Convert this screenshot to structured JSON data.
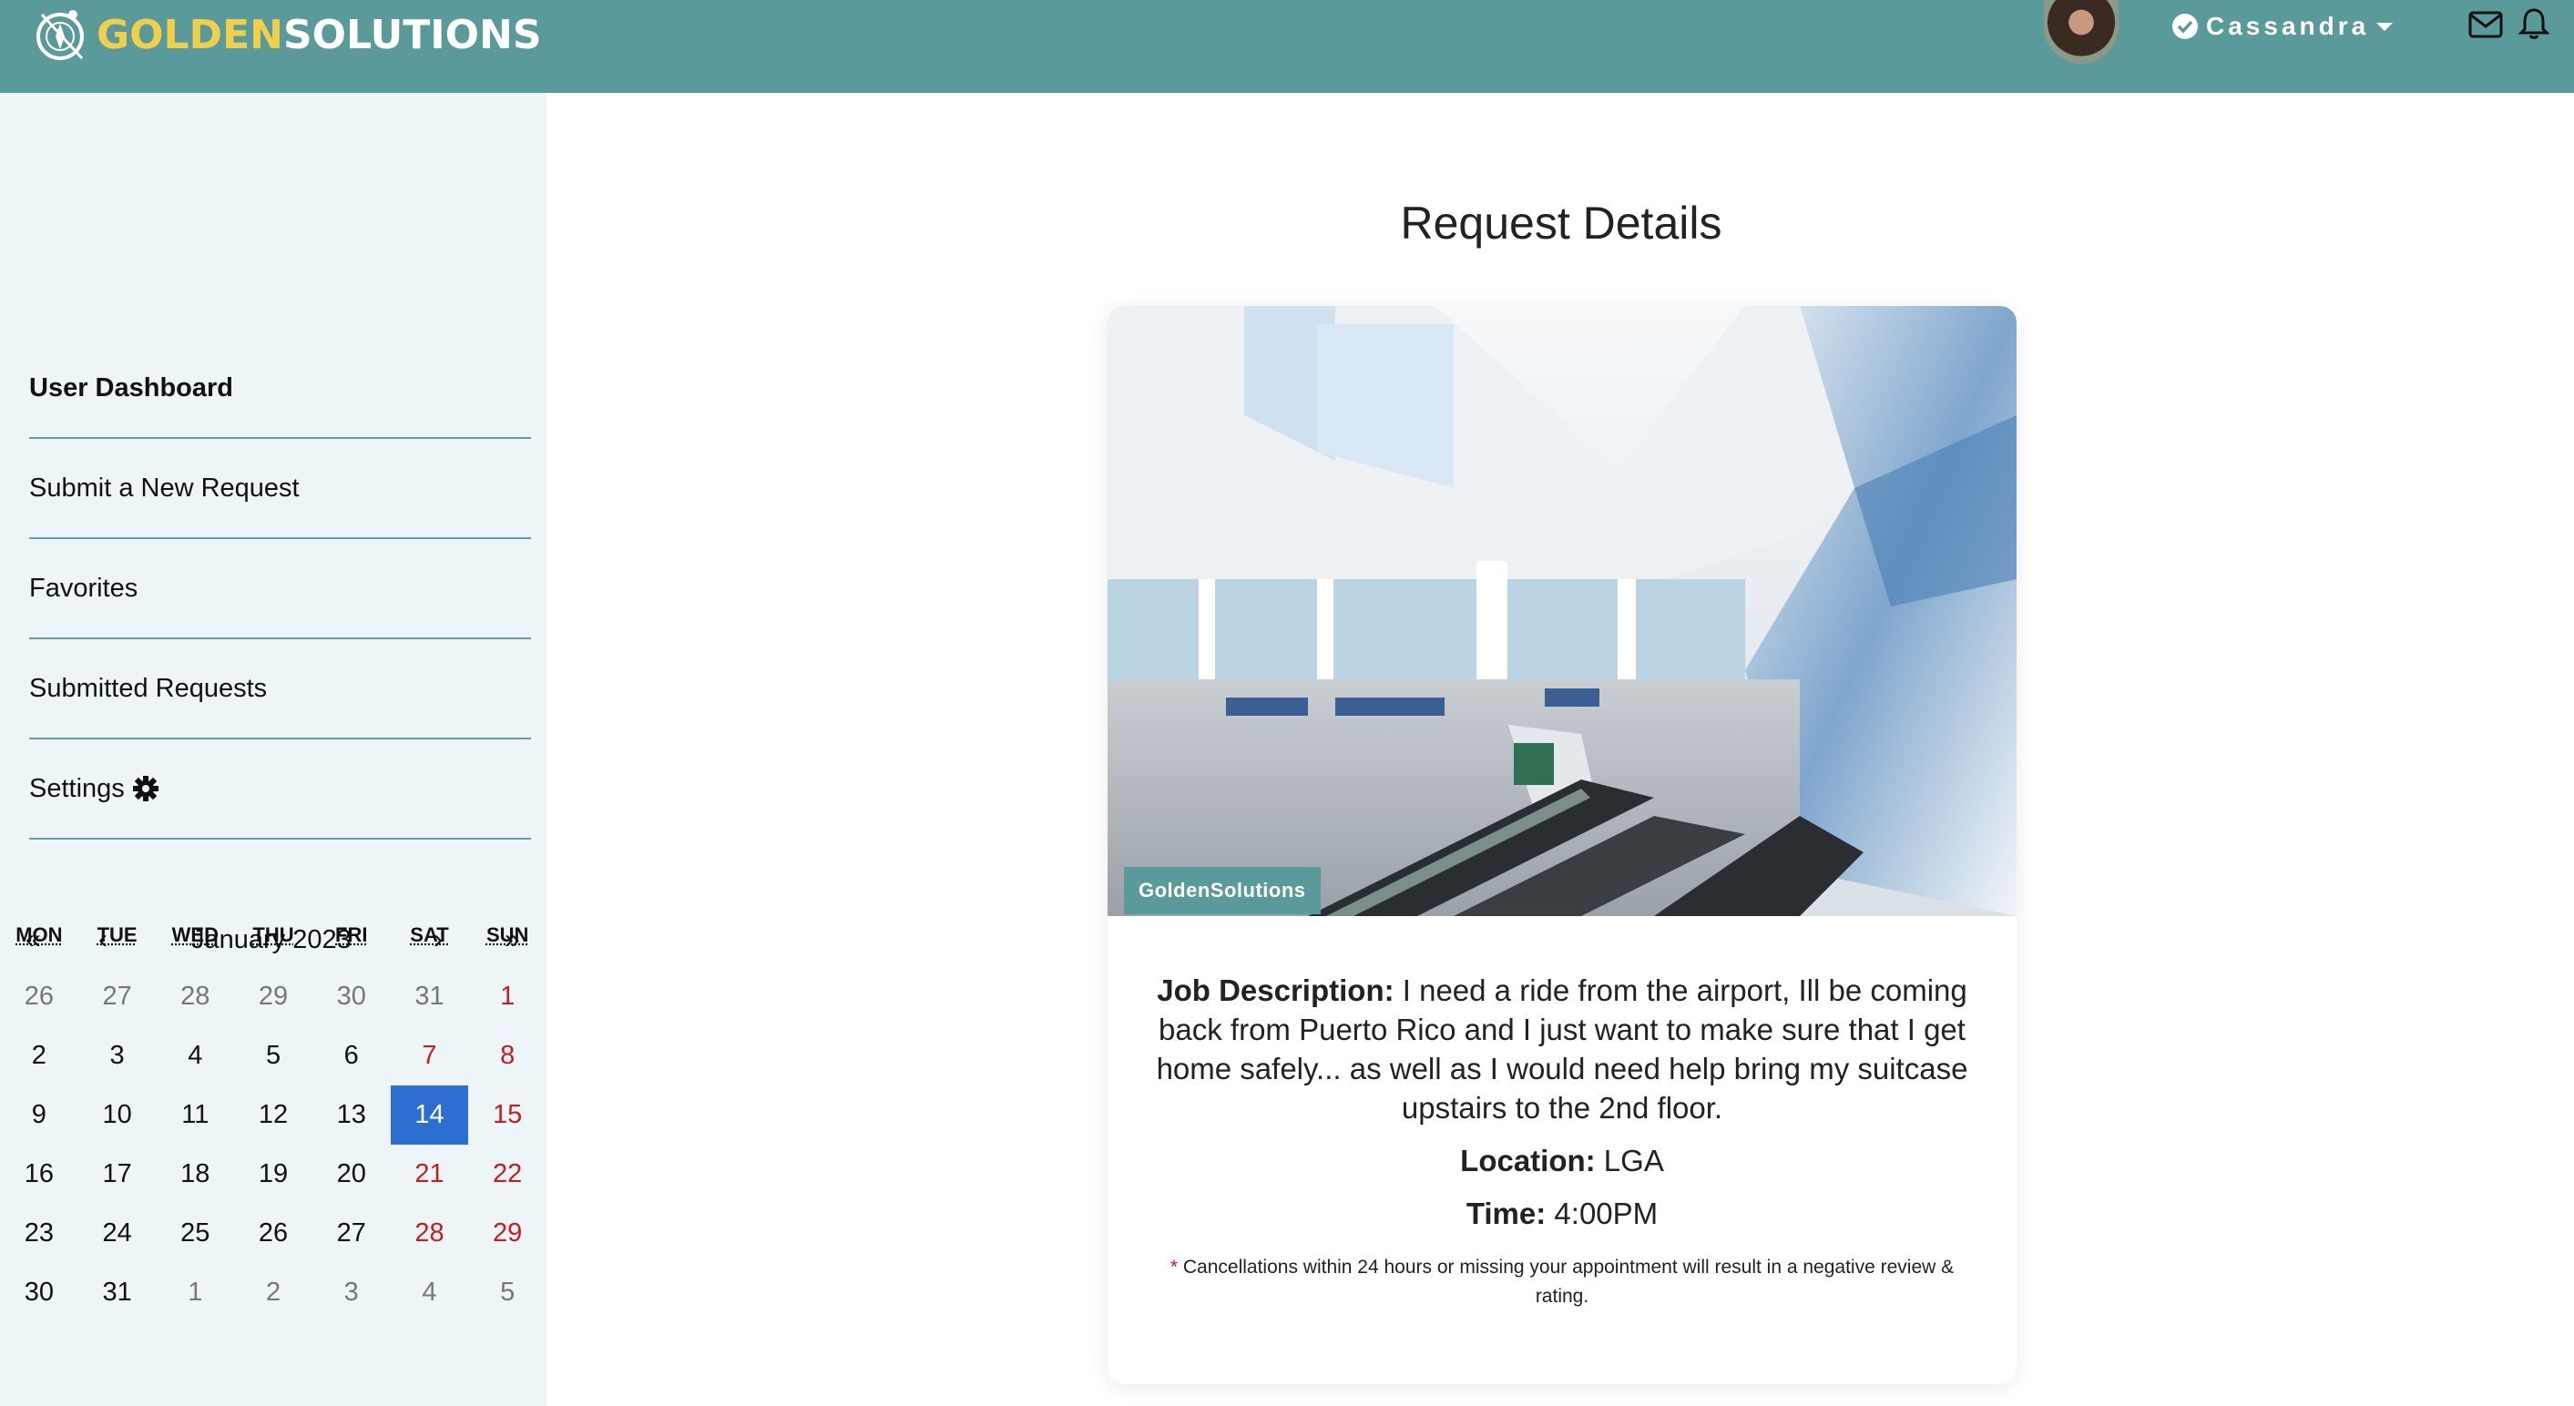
{
  "header": {
    "logo_golden": "GOLDEN",
    "logo_solutions": "SOLUTIONS",
    "username": "Cassandra"
  },
  "sidebar": {
    "items": [
      {
        "label": "User Dashboard"
      },
      {
        "label": "Submit a New Request"
      },
      {
        "label": "Favorites"
      },
      {
        "label": "Submitted Requests"
      },
      {
        "label": "Settings"
      }
    ]
  },
  "calendar": {
    "first": "«",
    "prev": "‹",
    "month": "January 2023",
    "next": "›",
    "last": "»",
    "weekdays": [
      "MON",
      "TUE",
      "WED",
      "THU",
      "FRI",
      "SAT",
      "SUN"
    ],
    "weeks": [
      [
        "26",
        "27",
        "28",
        "29",
        "30",
        "31",
        "1"
      ],
      [
        "2",
        "3",
        "4",
        "5",
        "6",
        "7",
        "8"
      ],
      [
        "9",
        "10",
        "11",
        "12",
        "13",
        "14",
        "15"
      ],
      [
        "16",
        "17",
        "18",
        "19",
        "20",
        "21",
        "22"
      ],
      [
        "23",
        "24",
        "25",
        "26",
        "27",
        "28",
        "29"
      ],
      [
        "30",
        "31",
        "1",
        "2",
        "3",
        "4",
        "5"
      ]
    ],
    "selected": "14"
  },
  "main": {
    "title": "Request Details",
    "photo_badge": "GoldenSolutions",
    "job_label": "Job Description:",
    "job_text": " I need a ride from the airport, Ill be coming back from Puerto Rico and I just want to make sure that I get home safely... as well as I would need help bring my suitcase upstairs to the 2nd floor.",
    "location_label": "Location:",
    "location_value": " LGA",
    "time_label": "Time:",
    "time_value": " 4:00PM",
    "note_asterisk": "*",
    "note_text": " Cancellations within 24 hours or missing your appointment will result in a negative review & rating."
  },
  "colors": {
    "header": "#5a9a9a",
    "sidebar": "#eef5f8",
    "selected_day": "#2c6fd1",
    "weekend": "#c41e1e",
    "logo_gold": "#f0cf4a"
  }
}
